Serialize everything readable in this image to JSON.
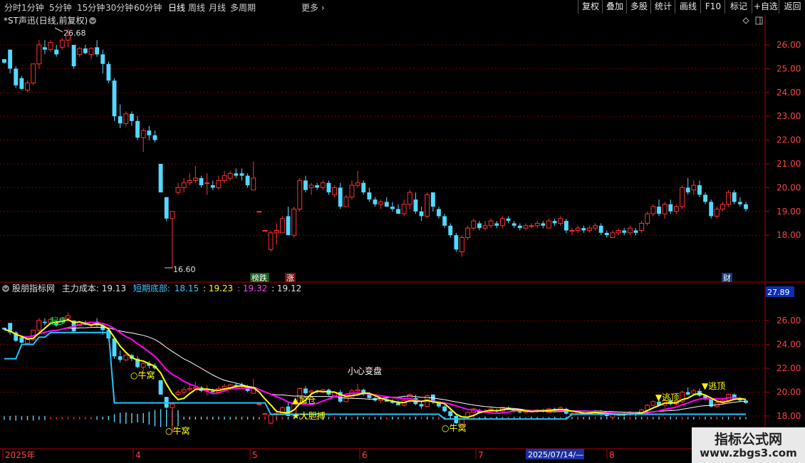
{
  "toolbar": {
    "periods": [
      "分时",
      "1分钟",
      "5分钟",
      "15分钟",
      "30分钟",
      "60分钟",
      "日线",
      "周线",
      "月线",
      "多周期"
    ],
    "active_period": "日线",
    "more": "更多",
    "right_buttons": [
      "复权",
      "叠加",
      "多股",
      "统计",
      "画线",
      "F10",
      "标记",
      "+自选",
      "返回"
    ]
  },
  "main": {
    "title": "*ST声迅(日线,前复权)",
    "high_label": "26.68",
    "low_label": "16.60",
    "price_ticks": [
      "26.00",
      "25.00",
      "24.00",
      "23.00",
      "22.00",
      "21.00",
      "20.00",
      "19.00",
      "18.00"
    ],
    "markers": [
      {
        "text": "榜跌",
        "color": "#ffffff",
        "bg": "#1a5a1a"
      },
      {
        "text": "涨",
        "color": "#ffffff",
        "bg": "#7a1010"
      },
      {
        "text": "财",
        "color": "#ffffff",
        "bg": "#103a7a"
      }
    ]
  },
  "indicator": {
    "name": "股朋指标网",
    "main_cost_label": "主力成本:",
    "main_cost_value": "19.13",
    "short_bottom_label": "短期底部:",
    "v1": "18.15",
    "v2": ": 19.23",
    "v3": ": 19.32",
    "v4": ": 19.12",
    "box_value": "27.89",
    "ticks": [
      "26.00",
      "24.00",
      "22.00",
      "20.00",
      "18.00"
    ],
    "annotations": [
      "牛窝",
      "牛窝",
      "牛窝",
      "加仓",
      "大胆搏",
      "小心变盘",
      "逃顶",
      "逃顶",
      "起步"
    ]
  },
  "xaxis": {
    "labels": [
      "2025年",
      "4",
      "5",
      "6",
      "7",
      "8"
    ],
    "cursor_date": "2025/07/14/—"
  },
  "watermark": {
    "line1": "指标公式网",
    "line2": "www.zbgs3.com"
  },
  "colors": {
    "up": "#ff3232",
    "down": "#54d8ff",
    "grid": "#7a0000",
    "frame": "#b00000",
    "yellow": "#ffff00",
    "magenta": "#ff00ff",
    "white": "#ffffff",
    "cyan": "#1ec8ff"
  },
  "chart_data": {
    "type": "candlestick",
    "ohlc": [
      [
        25.4,
        25.4,
        25.2,
        25.25
      ],
      [
        25.8,
        25.8,
        24.8,
        25.0
      ],
      [
        25.0,
        25.1,
        24.2,
        24.3
      ],
      [
        24.6,
        24.7,
        24.1,
        24.15
      ],
      [
        24.1,
        24.5,
        24.0,
        24.4
      ],
      [
        24.4,
        25.2,
        24.3,
        25.2
      ],
      [
        25.2,
        26.2,
        25.0,
        26.0
      ],
      [
        25.9,
        26.2,
        25.6,
        25.8
      ],
      [
        25.8,
        26.2,
        25.7,
        26.1
      ],
      [
        25.8,
        26.0,
        25.5,
        25.6
      ],
      [
        25.9,
        26.3,
        25.8,
        26.2
      ],
      [
        26.2,
        26.68,
        25.9,
        26.4
      ],
      [
        26.0,
        26.0,
        25.0,
        25.1
      ],
      [
        25.6,
        25.9,
        25.5,
        25.85
      ],
      [
        25.85,
        26.0,
        25.6,
        25.65
      ],
      [
        25.6,
        25.9,
        25.4,
        25.85
      ],
      [
        25.9,
        26.2,
        25.5,
        25.6
      ],
      [
        25.6,
        25.8,
        24.8,
        25.2
      ],
      [
        25.2,
        25.3,
        24.4,
        24.5
      ],
      [
        24.5,
        24.6,
        22.8,
        23.0
      ],
      [
        23.0,
        23.5,
        22.5,
        22.7
      ],
      [
        22.7,
        23.2,
        22.6,
        23.1
      ],
      [
        23.1,
        23.2,
        22.6,
        22.8
      ],
      [
        22.8,
        23.0,
        22.0,
        22.1
      ],
      [
        22.1,
        22.5,
        21.5,
        22.4
      ],
      [
        22.4,
        22.6,
        22.0,
        22.2
      ],
      [
        22.2,
        22.4,
        21.9,
        22.0
      ],
      [
        21.0,
        21.0,
        19.8,
        19.8
      ],
      [
        19.6,
        19.6,
        18.6,
        18.7
      ],
      [
        18.7,
        19.0,
        16.6,
        19.0
      ],
      [
        19.8,
        20.2,
        19.7,
        20.0
      ],
      [
        20.0,
        20.4,
        19.8,
        20.2
      ],
      [
        20.2,
        20.6,
        20.1,
        20.3
      ],
      [
        20.3,
        20.9,
        20.2,
        20.4
      ],
      [
        20.4,
        20.5,
        20.0,
        20.1
      ],
      [
        20.2,
        20.6,
        19.7,
        20.2
      ],
      [
        20.1,
        20.3,
        19.9,
        20.0
      ],
      [
        20.0,
        20.5,
        19.9,
        20.3
      ],
      [
        20.3,
        20.7,
        20.2,
        20.5
      ],
      [
        20.4,
        20.7,
        20.3,
        20.6
      ],
      [
        20.6,
        20.8,
        20.4,
        20.5
      ],
      [
        20.6,
        20.8,
        20.3,
        20.5
      ],
      [
        20.5,
        20.6,
        20.0,
        20.1
      ],
      [
        19.9,
        21.1,
        19.9,
        20.4
      ],
      [
        19.0,
        19.0,
        19.0,
        19.0
      ],
      [
        18.2,
        18.2,
        18.2,
        18.2
      ],
      [
        17.4,
        18.2,
        17.3,
        18.1
      ],
      [
        18.1,
        18.5,
        17.6,
        18.2
      ],
      [
        18.1,
        18.8,
        18.1,
        18.7
      ],
      [
        18.8,
        19.2,
        18.0,
        18.0
      ],
      [
        18.0,
        19.2,
        17.9,
        19.1
      ],
      [
        19.1,
        20.4,
        19.0,
        20.3
      ],
      [
        20.3,
        20.5,
        19.8,
        19.9
      ],
      [
        20.0,
        20.2,
        19.7,
        20.1
      ],
      [
        20.1,
        20.2,
        19.9,
        20.0
      ],
      [
        20.0,
        20.3,
        19.9,
        20.2
      ],
      [
        20.2,
        20.3,
        19.7,
        19.8
      ],
      [
        19.7,
        20.1,
        19.6,
        20.0
      ],
      [
        20.0,
        20.2,
        19.1,
        19.2
      ],
      [
        19.2,
        19.7,
        19.2,
        19.6
      ],
      [
        19.6,
        20.3,
        19.5,
        20.1
      ],
      [
        20.1,
        20.7,
        20.0,
        20.2
      ],
      [
        20.2,
        20.3,
        19.7,
        19.8
      ],
      [
        19.8,
        20.0,
        19.4,
        19.5
      ],
      [
        19.5,
        19.6,
        19.2,
        19.3
      ],
      [
        19.3,
        19.5,
        19.1,
        19.4
      ],
      [
        19.4,
        19.6,
        19.2,
        19.2
      ],
      [
        19.2,
        19.4,
        19.0,
        19.1
      ],
      [
        19.1,
        19.3,
        18.9,
        18.9
      ],
      [
        18.9,
        19.5,
        18.8,
        19.3
      ],
      [
        19.3,
        19.9,
        19.1,
        19.8
      ],
      [
        19.5,
        19.8,
        18.9,
        19.0
      ],
      [
        19.0,
        19.2,
        18.6,
        18.8
      ],
      [
        18.8,
        19.8,
        18.7,
        19.7
      ],
      [
        19.8,
        19.8,
        19.0,
        19.2
      ],
      [
        19.1,
        19.2,
        18.7,
        18.8
      ],
      [
        18.8,
        18.9,
        18.3,
        18.4
      ],
      [
        18.4,
        18.5,
        17.9,
        18.0
      ],
      [
        18.0,
        18.1,
        17.3,
        17.4
      ],
      [
        17.3,
        18.0,
        17.1,
        17.9
      ],
      [
        17.9,
        18.4,
        17.8,
        18.3
      ],
      [
        18.3,
        18.7,
        18.2,
        18.6
      ],
      [
        18.5,
        18.6,
        18.2,
        18.3
      ],
      [
        18.3,
        18.6,
        18.2,
        18.4
      ],
      [
        18.4,
        18.7,
        18.3,
        18.6
      ],
      [
        18.5,
        18.6,
        18.3,
        18.4
      ],
      [
        18.4,
        18.8,
        18.3,
        18.7
      ],
      [
        18.7,
        18.8,
        18.5,
        18.6
      ],
      [
        18.5,
        18.6,
        18.3,
        18.4
      ],
      [
        18.4,
        18.5,
        18.2,
        18.3
      ],
      [
        18.3,
        18.5,
        18.2,
        18.4
      ],
      [
        18.4,
        18.5,
        18.3,
        18.4
      ],
      [
        18.4,
        18.6,
        18.3,
        18.5
      ],
      [
        18.5,
        18.6,
        18.3,
        18.4
      ],
      [
        18.3,
        18.7,
        18.3,
        18.6
      ],
      [
        18.6,
        18.7,
        18.4,
        18.5
      ],
      [
        18.5,
        18.8,
        18.4,
        18.7
      ],
      [
        18.6,
        18.7,
        18.1,
        18.2
      ],
      [
        18.2,
        18.3,
        18.0,
        18.2
      ],
      [
        18.2,
        18.4,
        18.1,
        18.3
      ],
      [
        18.3,
        18.4,
        18.1,
        18.2
      ],
      [
        18.2,
        18.4,
        18.1,
        18.3
      ],
      [
        18.3,
        18.5,
        18.2,
        18.4
      ],
      [
        18.4,
        18.5,
        18.0,
        18.1
      ],
      [
        18.1,
        18.2,
        17.9,
        18.0
      ],
      [
        17.9,
        18.2,
        17.9,
        18.1
      ],
      [
        18.1,
        18.3,
        18.0,
        18.2
      ],
      [
        18.2,
        18.3,
        18.0,
        18.1
      ],
      [
        18.1,
        18.4,
        18.0,
        18.3
      ],
      [
        18.2,
        18.3,
        18.0,
        18.1
      ],
      [
        18.2,
        18.6,
        18.1,
        18.5
      ],
      [
        18.5,
        19.0,
        18.4,
        18.9
      ],
      [
        18.9,
        19.3,
        18.8,
        19.2
      ],
      [
        19.2,
        19.5,
        18.8,
        18.9
      ],
      [
        18.9,
        19.4,
        18.7,
        19.3
      ],
      [
        19.3,
        19.5,
        18.9,
        19.0
      ],
      [
        19.0,
        19.3,
        18.9,
        19.2
      ],
      [
        19.2,
        20.1,
        19.1,
        20.0
      ],
      [
        20.0,
        20.4,
        19.7,
        19.8
      ],
      [
        19.9,
        20.3,
        19.7,
        20.1
      ],
      [
        20.1,
        20.3,
        19.6,
        19.7
      ],
      [
        19.7,
        19.8,
        19.3,
        19.4
      ],
      [
        19.4,
        19.5,
        18.7,
        18.8
      ],
      [
        18.8,
        19.2,
        18.7,
        19.1
      ],
      [
        19.1,
        19.4,
        19.0,
        19.3
      ],
      [
        19.3,
        19.9,
        19.2,
        19.8
      ],
      [
        19.8,
        19.9,
        19.3,
        19.4
      ],
      [
        19.4,
        19.6,
        19.2,
        19.3
      ],
      [
        19.3,
        19.4,
        19.0,
        19.1
      ]
    ],
    "price_range": [
      17.0,
      27.0
    ],
    "indicator_range": [
      17.0,
      27.0
    ]
  }
}
